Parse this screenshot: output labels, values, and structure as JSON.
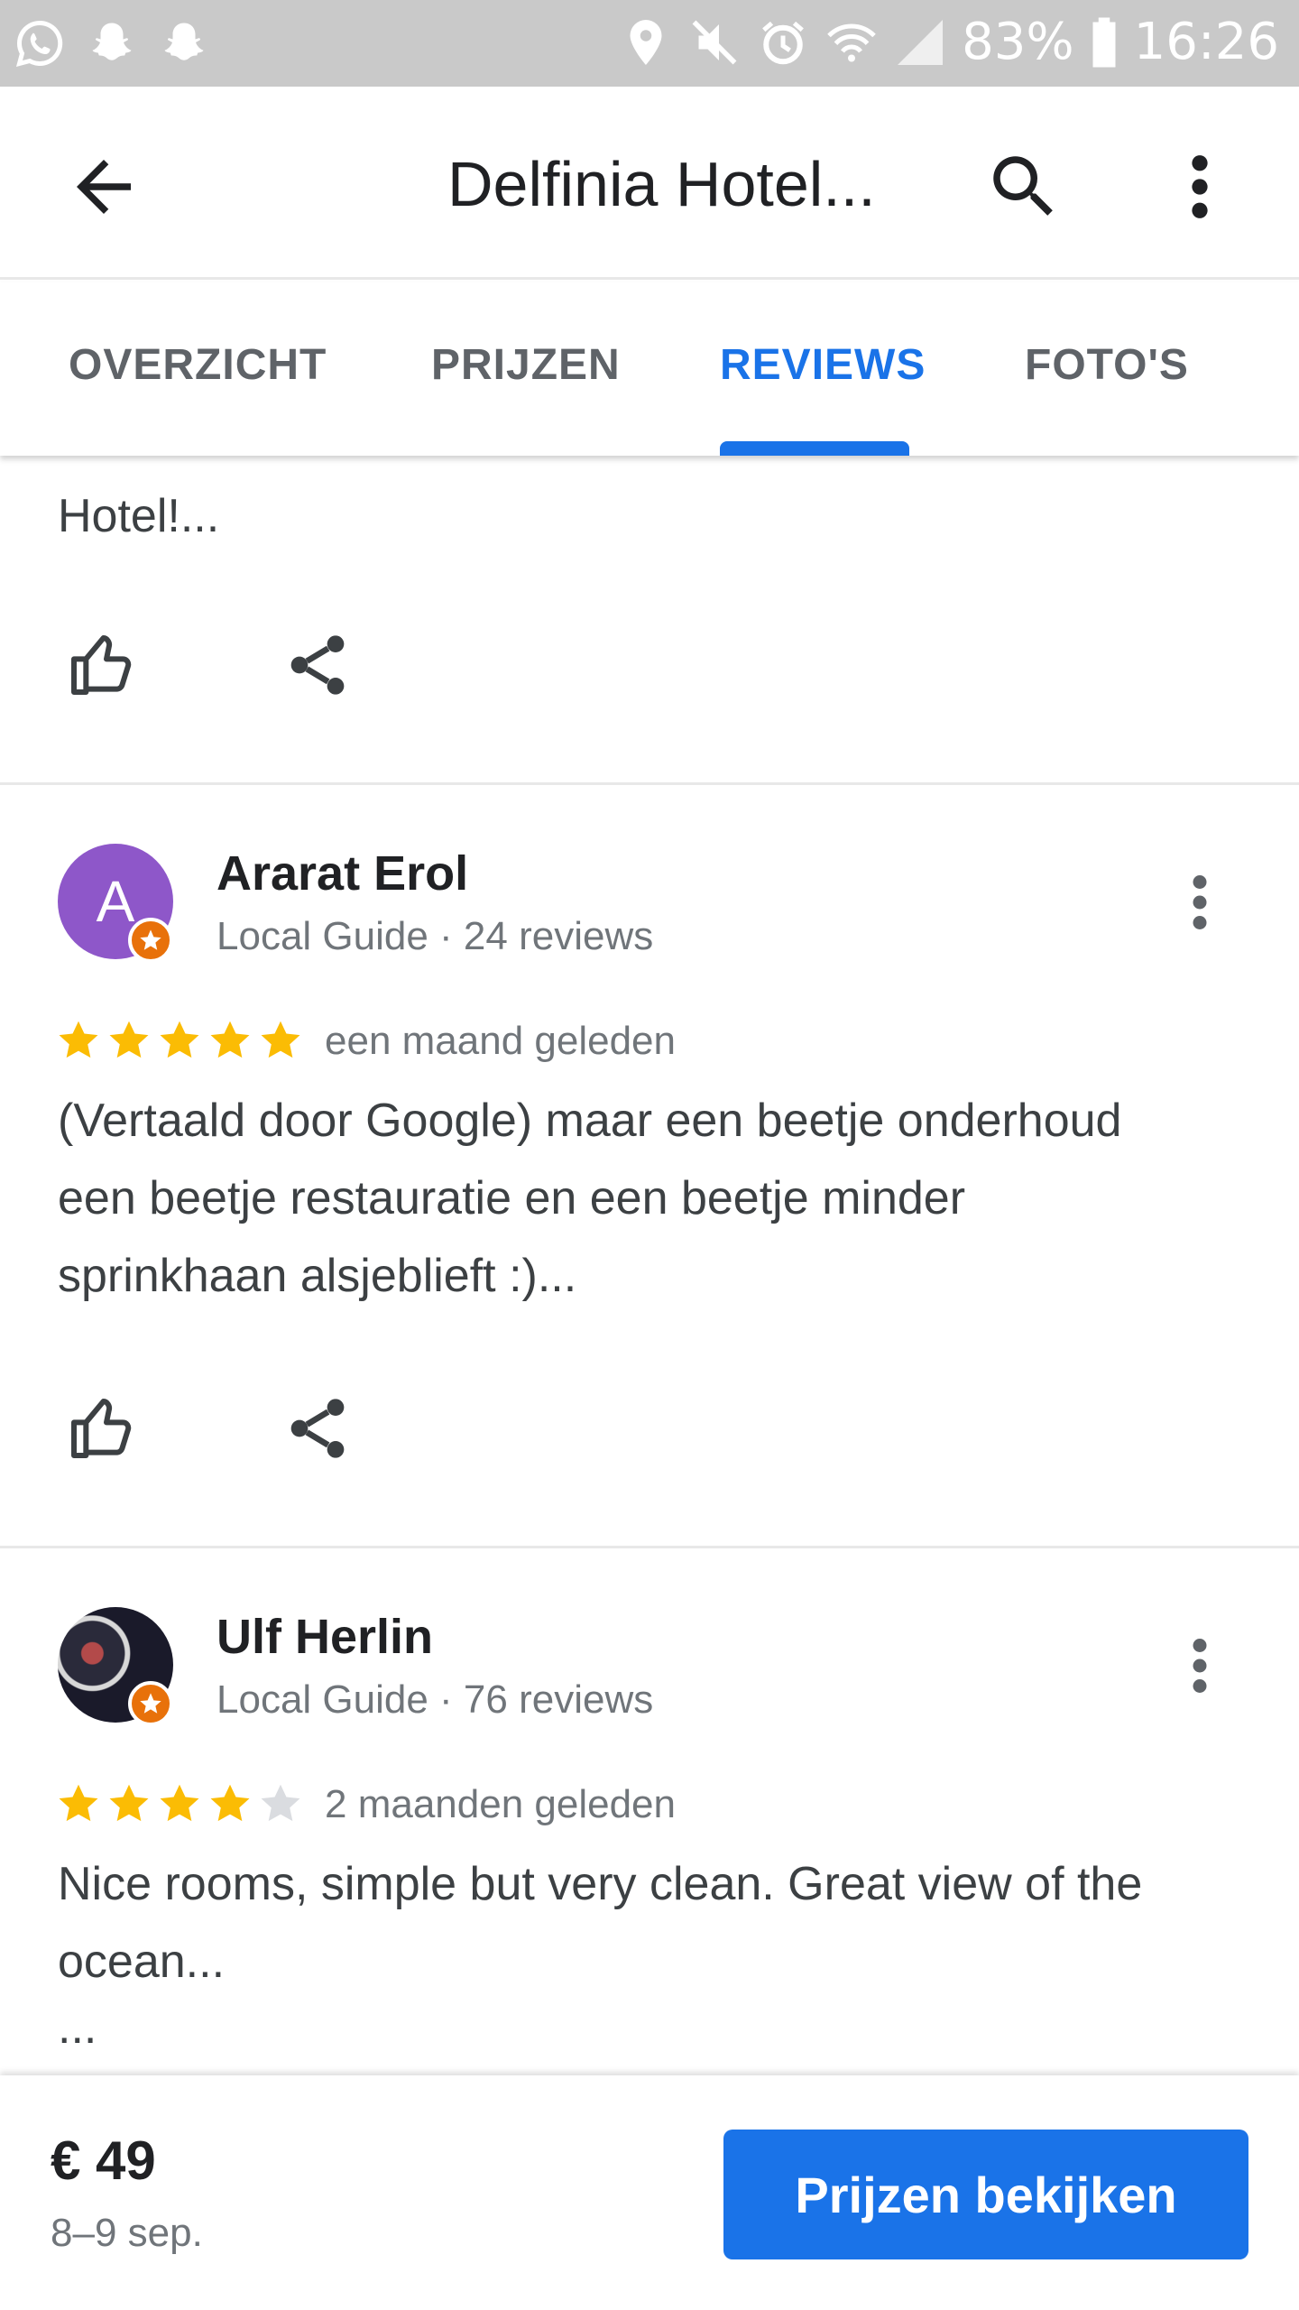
{
  "status_bar": {
    "left_icons": [
      "whatsapp-icon",
      "snapchat-icon",
      "snapchat-icon"
    ],
    "right_icons": [
      "location-icon",
      "mute-icon",
      "alarm-icon",
      "wifi-icon",
      "signal-icon"
    ],
    "battery": "83%",
    "time": "16:26"
  },
  "app_bar": {
    "title": "Delfinia Hotel..."
  },
  "tabs": [
    {
      "label": "OVERZICHT",
      "active": false
    },
    {
      "label": "PRIJZEN",
      "active": false
    },
    {
      "label": "REVIEWS",
      "active": true
    },
    {
      "label": "FOTO'S",
      "active": false
    }
  ],
  "previous_review": {
    "text_end": "Hotel!..."
  },
  "reviews": [
    {
      "name": "Ararat Erol",
      "avatar_letter": "A",
      "avatar_color": "#8e57c9",
      "meta": "Local Guide · 24 reviews",
      "rating": 5,
      "time": "een maand geleden",
      "body_lines": [
        "(Vertaald door Google) maar een beetje onderhoud",
        "een beetje restauratie en een beetje minder",
        "sprinkhaan alsjeblieft :)..."
      ]
    },
    {
      "name": "Ulf Herlin",
      "meta": "Local Guide · 76 reviews",
      "rating": 4,
      "time": "2 maanden geleden",
      "body_lines": [
        "Nice rooms, simple but very clean. Great view of the",
        "ocean...",
        "..."
      ]
    }
  ],
  "bottom_bar": {
    "price": "€ 49",
    "dates": "8–9 sep.",
    "cta_label": "Prijzen bekijken"
  },
  "colors": {
    "accent": "#1a73e8",
    "star": "#fbbc04",
    "star_empty": "#dadce0",
    "guide_badge": "#e8710a"
  }
}
